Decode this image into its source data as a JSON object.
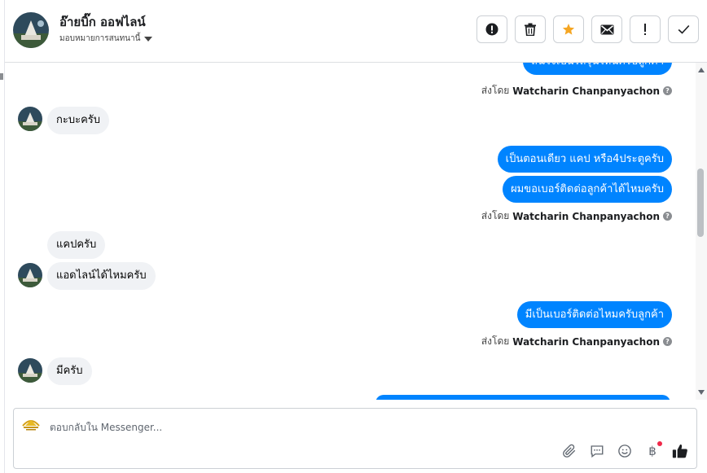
{
  "header": {
    "name": "อ๊ายบิ๊ก ออฟไลน์",
    "assign_label": "มอบหมายการสนทนานี้"
  },
  "actions": [
    {
      "name": "mark-spam-button",
      "icon": "alert-circle-icon"
    },
    {
      "name": "delete-button",
      "icon": "trash-icon"
    },
    {
      "name": "star-button",
      "icon": "star-icon"
    },
    {
      "name": "mark-unread-button",
      "icon": "envelope-icon"
    },
    {
      "name": "follow-up-button",
      "icon": "exclamation-icon"
    },
    {
      "name": "mark-done-button",
      "icon": "check-icon"
    }
  ],
  "messages": {
    "m0": "สนใจเป็นรถรุ่นไหนครับลูกค้า",
    "m1": "กะบะครับ",
    "m2": "เป็นตอนเดียว แคป หรือ4ประตูครับ",
    "m3": "ผมขอเบอร์ติดต่อลูกค้าได้ไหมครับ",
    "m4": "แคปครับ",
    "m5": "แอดไลน์ได้ไหมครับ",
    "m6": "มีเป็นเบอร์ติดต่อไหมครับลูกค้า",
    "m7": "มีครับ"
  },
  "sent_by": {
    "prefix": "ส่งโดย",
    "agent": "Watcharin Chanpanyachon"
  },
  "composer": {
    "placeholder": "ตอบกลับใน Messenger..."
  },
  "colors": {
    "outgoing_bubble": "#0084ff",
    "incoming_bubble": "#f0f2f5",
    "star": "#f5a623",
    "like": "#1c1e21"
  }
}
